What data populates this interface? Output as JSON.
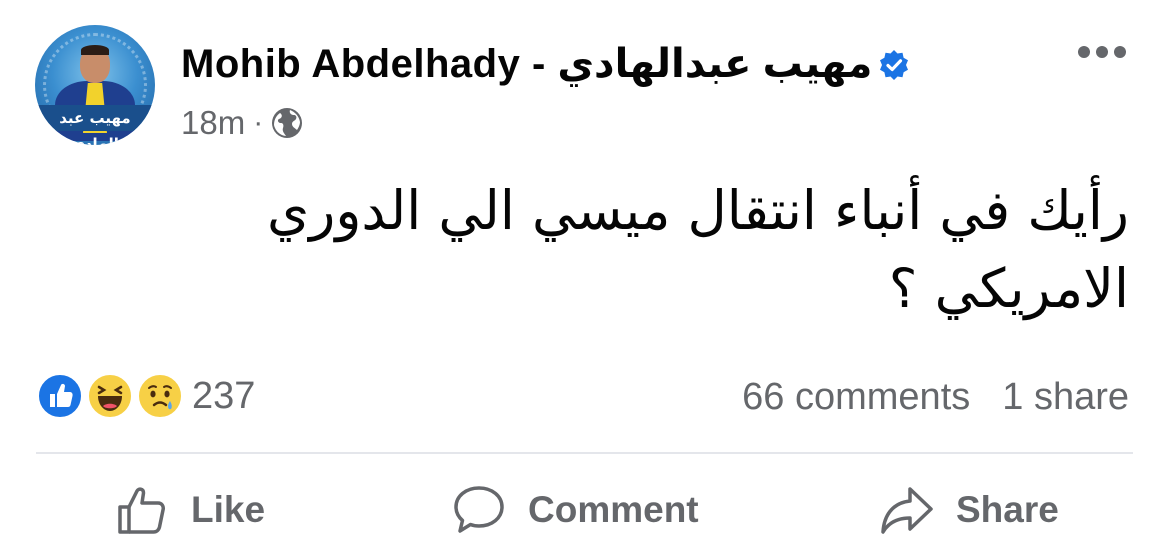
{
  "post": {
    "author": {
      "name": "Mohib Abdelhady - مهيب عبدالهادي",
      "avatar_caption": "مهيب عبد الهادي",
      "verified": true
    },
    "timestamp": "18m",
    "separator": "·",
    "audience_icon": "globe-icon",
    "text": "رأيك في أنباء انتقال ميسي الي الدوري الامريكي ؟",
    "reactions": {
      "icons": [
        "like-icon",
        "haha-icon",
        "sad-icon"
      ],
      "count": "237"
    },
    "comments_count": "66 comments",
    "shares_count": "1 share"
  },
  "actions": {
    "like_label": "Like",
    "comment_label": "Comment",
    "share_label": "Share"
  },
  "colors": {
    "accent": "#1b74e4",
    "secondary_text": "#65676b",
    "divider": "#e4e6eb"
  }
}
